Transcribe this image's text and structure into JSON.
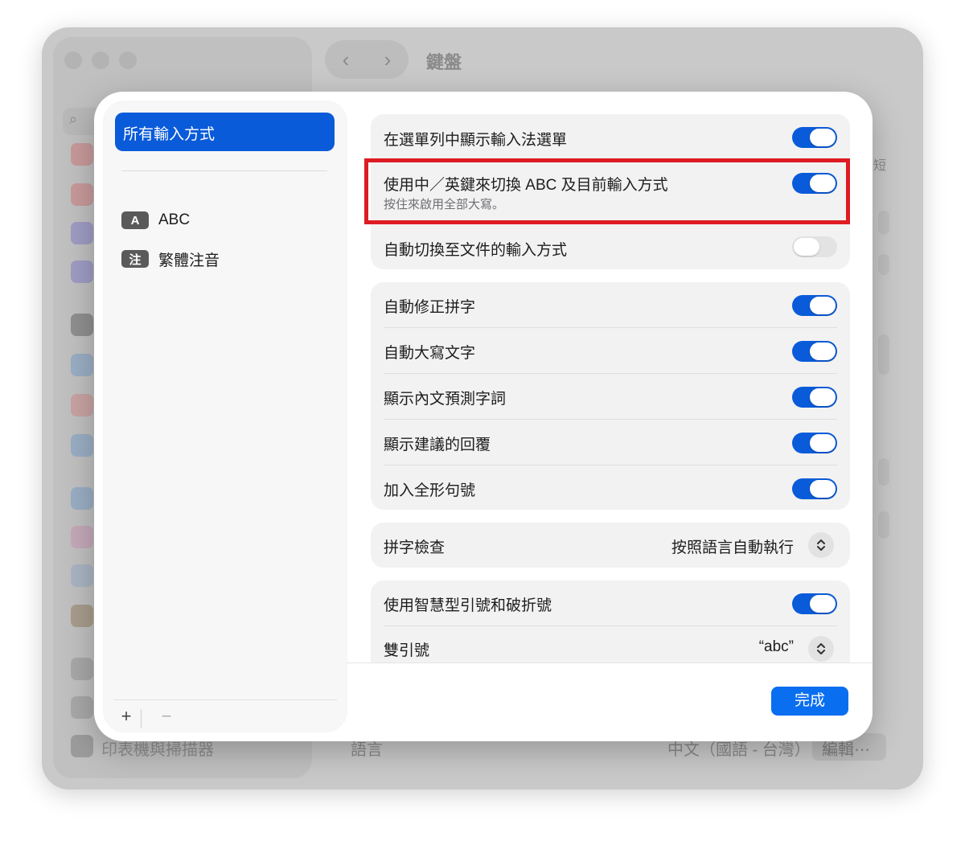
{
  "background_window": {
    "title": "鍵盤",
    "search_icon": "magnifier",
    "sidebar_bottom_item": "印表機與掃描器",
    "language_label": "語言",
    "language_value": "中文（國語 - 台灣）",
    "edit_button": "編輯⋯",
    "partial_text": "短"
  },
  "sheet": {
    "sidebar": {
      "selected_item": "所有輸入方式",
      "input_sources": [
        {
          "badge": "A",
          "label": "ABC"
        },
        {
          "badge": "注",
          "label": "繁體注音"
        }
      ],
      "add_label": "+",
      "remove_label": "−"
    },
    "group1": {
      "rows": [
        {
          "label": "在選單列中顯示輸入法選單",
          "on": true
        },
        {
          "label": "使用中／英鍵來切換 ABC 及目前輸入方式",
          "sublabel": "按住來啟用全部大寫。",
          "on": true
        },
        {
          "label": "自動切換至文件的輸入方式",
          "on": false
        }
      ]
    },
    "group2": {
      "rows": [
        {
          "label": "自動修正拼字",
          "on": true
        },
        {
          "label": "自動大寫文字",
          "on": true
        },
        {
          "label": "顯示內文預測字詞",
          "on": true
        },
        {
          "label": "顯示建議的回覆",
          "on": true
        },
        {
          "label": "加入全形句號",
          "on": true
        }
      ]
    },
    "spelling": {
      "label": "拼字檢查",
      "value": "按照語言自動執行"
    },
    "group4": {
      "smart_quotes": {
        "label": "使用智慧型引號和破折號",
        "on": true
      },
      "double_quotes": {
        "label": "雙引號",
        "value": "“abc”"
      }
    },
    "done_button": "完成"
  },
  "colors": {
    "accent": "#0a5bd9",
    "button_blue": "#0a6ef0",
    "highlight_red": "#dd1c24"
  }
}
